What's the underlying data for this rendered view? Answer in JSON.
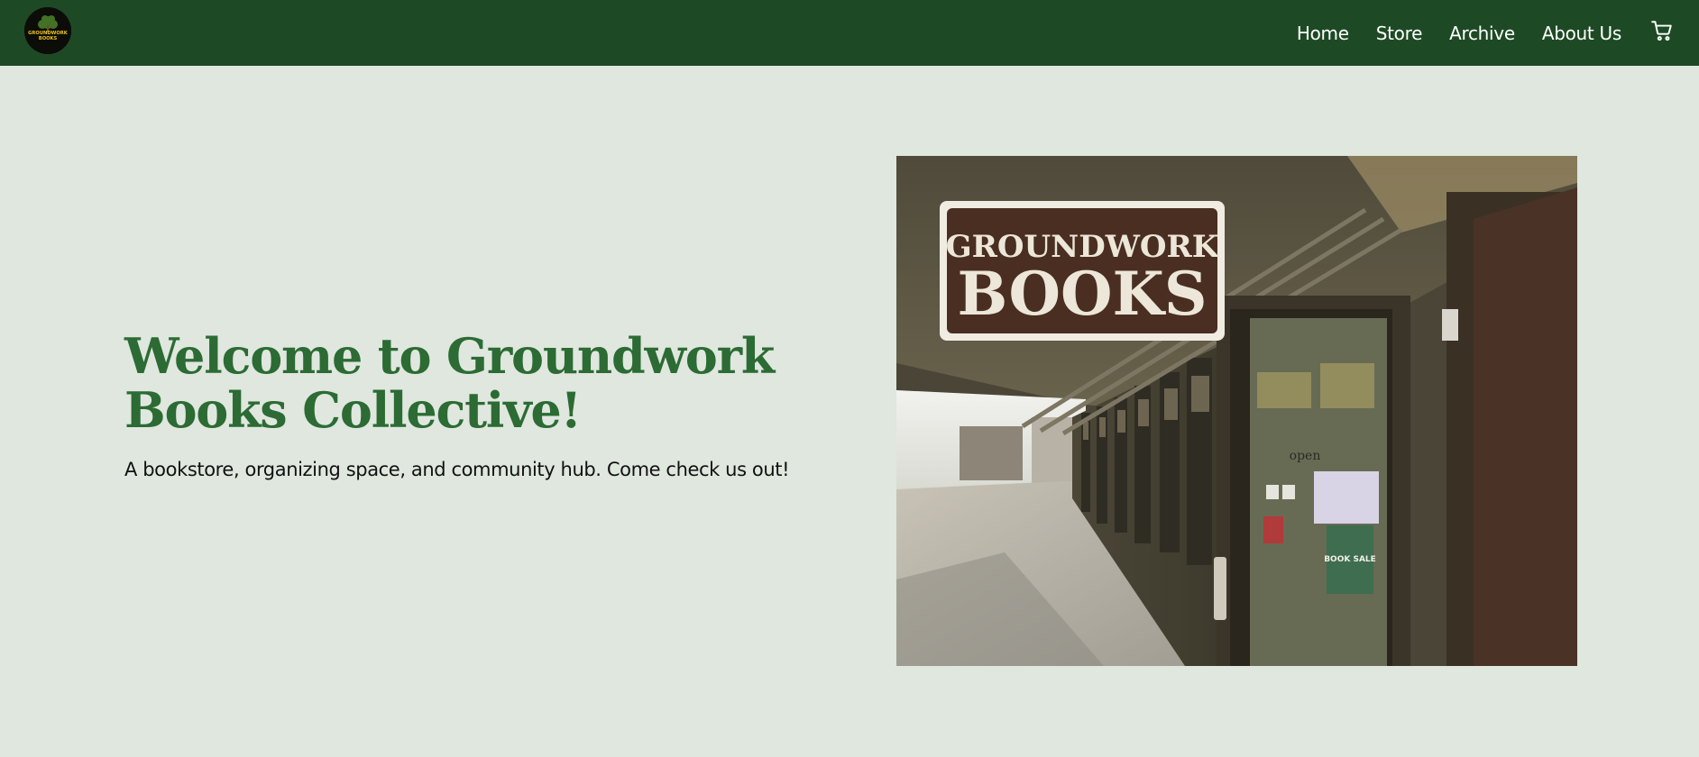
{
  "header": {
    "logo": {
      "icon": "groundwork-books-logo",
      "text_line1": "GROUNDWORK",
      "text_line2": "BOOKS"
    },
    "nav": [
      {
        "label": "Home"
      },
      {
        "label": "Store"
      },
      {
        "label": "Archive"
      },
      {
        "label": "About Us"
      }
    ],
    "cart_icon": "shopping-cart-icon",
    "background_color": "#1d4a24"
  },
  "hero": {
    "title": "Welcome to Groundwork Books Collective!",
    "subtitle": "A bookstore, organizing space, and community hub. Come check us out!",
    "title_color": "#2c6b33",
    "photo": {
      "sign_line1": "GROUNDWORK",
      "sign_line2": "BOOKS",
      "door_sign": "open",
      "poster_text": "BOOK SALE"
    }
  },
  "colors": {
    "page_background": "#dfe7df",
    "nav_text": "#ffffff"
  }
}
